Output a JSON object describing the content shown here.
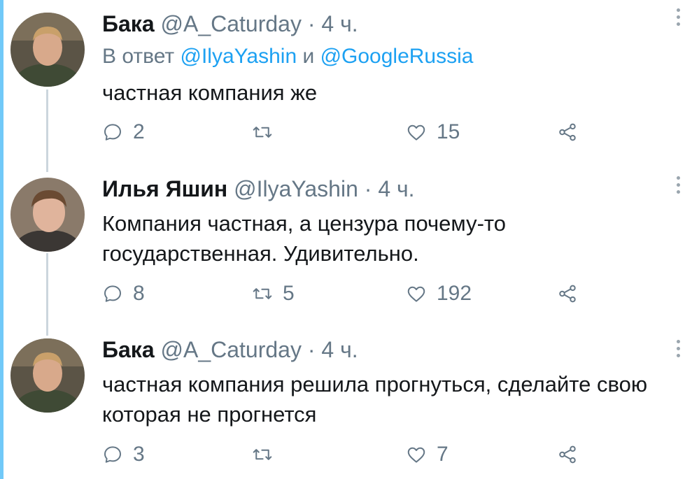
{
  "tweets": [
    {
      "name": "Бака",
      "handle": "@A_Caturday",
      "separator": "·",
      "time": "4 ч.",
      "reply_prefix": "В ответ",
      "reply_mention_1": "@IlyaYashin",
      "reply_joiner": "и",
      "reply_mention_2": "@GoogleRussia",
      "text": "частная компания же",
      "reply_count": "2",
      "retweet_count": "",
      "like_count": "15",
      "avatar_icon": "user-avatar"
    },
    {
      "name": "Илья Яшин",
      "handle": "@IlyaYashin",
      "separator": "·",
      "time": "4 ч.",
      "text": "Компания частная, а цензура почему-то государственная. Удивительно.",
      "reply_count": "8",
      "retweet_count": "5",
      "like_count": "192",
      "avatar_icon": "user-avatar"
    },
    {
      "name": "Бака",
      "handle": "@A_Caturday",
      "separator": "·",
      "time": "4 ч.",
      "text": "частная компания решила прогнуться, сделайте свою которая не прогнется",
      "reply_count": "3",
      "retweet_count": "",
      "like_count": "7",
      "avatar_icon": "user-avatar"
    }
  ],
  "icons": {
    "reply": "reply-icon",
    "retweet": "retweet-icon",
    "like": "heart-icon",
    "share": "share-icon",
    "more": "more-vertical-icon"
  },
  "colors": {
    "accent_bar": "#71c9f8",
    "mention": "#1da1f2",
    "secondary_text": "#657786",
    "thread_line": "#ccd6dd"
  }
}
